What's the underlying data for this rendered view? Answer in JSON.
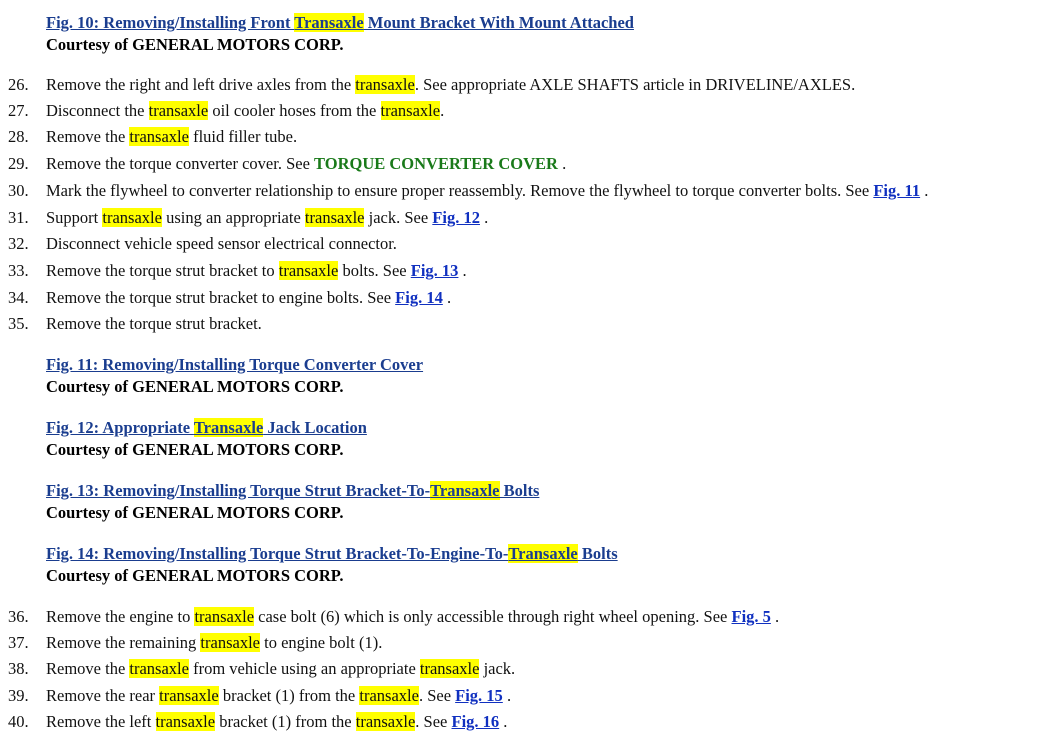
{
  "highlight_color": "#ffff00",
  "link_color": "#1a3d8f",
  "green_link_color": "#1a7a1a",
  "figures": [
    {
      "link_parts": [
        {
          "t": "Fig. 10: Removing/Installing Front "
        },
        {
          "t": "Transaxle",
          "hl": true
        },
        {
          "t": " Mount Bracket With Mount Attached"
        }
      ],
      "courtesy": "Courtesy of GENERAL MOTORS CORP."
    },
    {
      "link_parts": [
        {
          "t": "Fig. 11: Removing/Installing Torque Converter Cover"
        }
      ],
      "courtesy": "Courtesy of GENERAL MOTORS CORP."
    },
    {
      "link_parts": [
        {
          "t": "Fig. 12: Appropriate "
        },
        {
          "t": "Transaxle",
          "hl": true
        },
        {
          "t": " Jack Location"
        }
      ],
      "courtesy": "Courtesy of GENERAL MOTORS CORP."
    },
    {
      "link_parts": [
        {
          "t": "Fig. 13: Removing/Installing Torque Strut Bracket-To-"
        },
        {
          "t": "Transaxle",
          "hl": true
        },
        {
          "t": " Bolts"
        }
      ],
      "courtesy": "Courtesy of GENERAL MOTORS CORP."
    },
    {
      "link_parts": [
        {
          "t": "Fig. 14: Removing/Installing Torque Strut Bracket-To-Engine-To-"
        },
        {
          "t": "Transaxle",
          "hl": true
        },
        {
          "t": " Bolts"
        }
      ],
      "courtesy": "Courtesy of GENERAL MOTORS CORP."
    }
  ],
  "steps": [
    {
      "num": "26.",
      "parts": [
        {
          "t": "Remove the right and left drive axles from the "
        },
        {
          "t": "transaxle",
          "hl": true
        },
        {
          "t": ". See appropriate AXLE SHAFTS article in DRIVELINE/AXLES."
        }
      ]
    },
    {
      "num": "27.",
      "parts": [
        {
          "t": "Disconnect the "
        },
        {
          "t": "transaxle",
          "hl": true
        },
        {
          "t": " oil cooler hoses from the "
        },
        {
          "t": "transaxle",
          "hl": true
        },
        {
          "t": "."
        }
      ]
    },
    {
      "num": "28.",
      "parts": [
        {
          "t": "Remove the "
        },
        {
          "t": "transaxle",
          "hl": true
        },
        {
          "t": " fluid filler tube."
        }
      ]
    },
    {
      "num": "29.",
      "parts": [
        {
          "t": "Remove the torque converter cover. See "
        },
        {
          "t": "TORQUE CONVERTER COVER",
          "link": "green"
        },
        {
          "t": " ."
        }
      ]
    },
    {
      "num": "30.",
      "parts": [
        {
          "t": "Mark the flywheel to converter relationship to ensure proper reassembly. Remove the flywheel to torque converter bolts. See "
        },
        {
          "t": "Fig. 11",
          "link": "blue"
        },
        {
          "t": " ."
        }
      ]
    },
    {
      "num": "31.",
      "parts": [
        {
          "t": "Support "
        },
        {
          "t": "transaxle",
          "hl": true
        },
        {
          "t": " using an appropriate "
        },
        {
          "t": "transaxle",
          "hl": true
        },
        {
          "t": " jack. See "
        },
        {
          "t": "Fig. 12",
          "link": "blue"
        },
        {
          "t": " ."
        }
      ]
    },
    {
      "num": "32.",
      "parts": [
        {
          "t": "Disconnect vehicle speed sensor electrical connector."
        }
      ]
    },
    {
      "num": "33.",
      "parts": [
        {
          "t": "Remove the torque strut bracket to "
        },
        {
          "t": "transaxle",
          "hl": true
        },
        {
          "t": " bolts. See "
        },
        {
          "t": "Fig. 13",
          "link": "blue"
        },
        {
          "t": " ."
        }
      ]
    },
    {
      "num": "34.",
      "parts": [
        {
          "t": "Remove the torque strut bracket to engine bolts. See "
        },
        {
          "t": "Fig. 14",
          "link": "blue"
        },
        {
          "t": " ."
        }
      ]
    },
    {
      "num": "35.",
      "parts": [
        {
          "t": "Remove the torque strut bracket."
        }
      ]
    },
    {
      "num": "36.",
      "parts": [
        {
          "t": "Remove the engine to "
        },
        {
          "t": "transaxle",
          "hl": true
        },
        {
          "t": " case bolt (6) which is only accessible through right wheel opening. See "
        },
        {
          "t": "Fig. 5",
          "link": "blue"
        },
        {
          "t": " ."
        }
      ]
    },
    {
      "num": "37.",
      "parts": [
        {
          "t": "Remove the remaining "
        },
        {
          "t": "transaxle",
          "hl": true
        },
        {
          "t": " to engine bolt (1)."
        }
      ]
    },
    {
      "num": "38.",
      "parts": [
        {
          "t": "Remove the "
        },
        {
          "t": "transaxle",
          "hl": true
        },
        {
          "t": " from vehicle using an appropriate "
        },
        {
          "t": "transaxle",
          "hl": true
        },
        {
          "t": " jack."
        }
      ]
    },
    {
      "num": "39.",
      "parts": [
        {
          "t": "Remove the rear "
        },
        {
          "t": "transaxle",
          "hl": true
        },
        {
          "t": " bracket (1) from the "
        },
        {
          "t": "transaxle",
          "hl": true
        },
        {
          "t": ". See "
        },
        {
          "t": "Fig. 15",
          "link": "blue"
        },
        {
          "t": " ."
        }
      ]
    },
    {
      "num": "40.",
      "parts": [
        {
          "t": "Remove the left "
        },
        {
          "t": "transaxle",
          "hl": true
        },
        {
          "t": " bracket (1) from the "
        },
        {
          "t": "transaxle",
          "hl": true
        },
        {
          "t": ". See "
        },
        {
          "t": "Fig. 16",
          "link": "blue"
        },
        {
          "t": " ."
        }
      ]
    }
  ]
}
